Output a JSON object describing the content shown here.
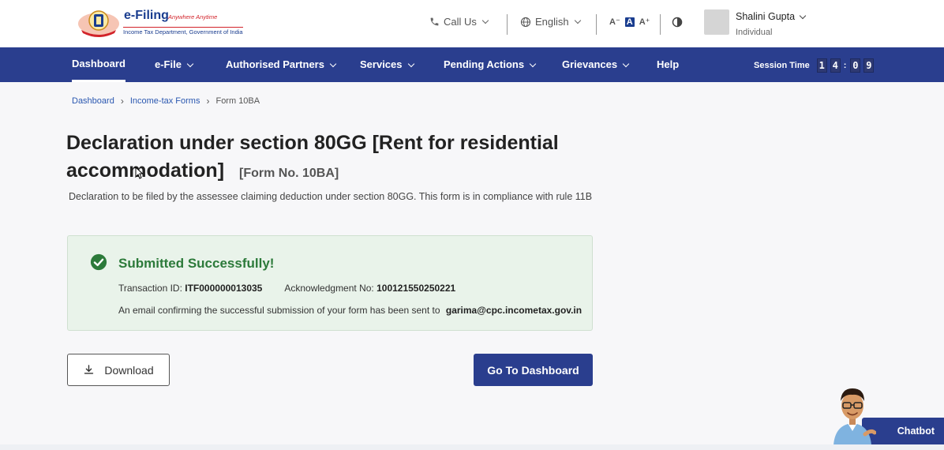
{
  "header": {
    "logo_title": "e-Filing",
    "logo_tagline": "Anywhere Anytime",
    "logo_subtitle": "Income Tax Department, Government of India",
    "call_us": "Call Us",
    "language": "English",
    "font_small": "A⁻",
    "font_normal": "A",
    "font_large": "A⁺",
    "user_name": "Shalini Gupta",
    "user_role": "Individual"
  },
  "nav": {
    "items": [
      {
        "label": "Dashboard"
      },
      {
        "label": "e-File"
      },
      {
        "label": "Authorised Partners"
      },
      {
        "label": "Services"
      },
      {
        "label": "Pending Actions"
      },
      {
        "label": "Grievances"
      },
      {
        "label": "Help"
      }
    ],
    "session_label": "Session Time",
    "session_digits": [
      "1",
      "4",
      "0",
      "9"
    ]
  },
  "breadcrumb": {
    "items": [
      "Dashboard",
      "Income-tax Forms",
      "Form 10BA"
    ]
  },
  "page": {
    "title": "Declaration under section 80GG [Rent for residential accommodation]",
    "form_no": "[Form No. 10BA]",
    "description": "Declaration to be filed by the assessee claiming deduction under section 80GG. This form is in compliance with rule 11B"
  },
  "success": {
    "title": "Submitted Successfully!",
    "txn_label": "Transaction ID:",
    "txn_value": "ITF000000013035",
    "ack_label": "Acknowledgment No:",
    "ack_value": "100121550250221",
    "email_text": "An email confirming the successful submission of your form has been sent to",
    "email_value": "garima@cpc.incometax.gov.in"
  },
  "buttons": {
    "download": "Download",
    "go_dashboard": "Go To Dashboard"
  },
  "chatbot": {
    "label": "Chatbot"
  },
  "colors": {
    "primary": "#2a3e8e",
    "success": "#2c7a3a",
    "success_bg": "#e9f3ea"
  }
}
